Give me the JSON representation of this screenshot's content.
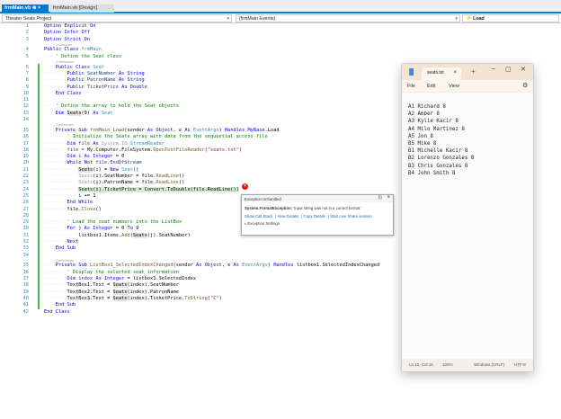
{
  "tabs": [
    {
      "label": "frmMain.vb",
      "pin": "⊕",
      "close": "×"
    },
    {
      "label": "frmMain.vb [Design]"
    }
  ],
  "nav": {
    "project": "Theater Seats Project",
    "events": "(frmMain Events)",
    "member": "Load"
  },
  "code": [
    {
      "n": "1",
      "seg": [
        [
          "Option Explicit On",
          "k"
        ]
      ]
    },
    {
      "n": "2",
      "seg": [
        [
          "Option Infer Off",
          "k"
        ]
      ]
    },
    {
      "n": "3",
      "seg": [
        [
          "Option Strict On",
          "k"
        ]
      ]
    },
    {
      "ref": "1 reference"
    },
    {
      "n": "4",
      "seg": [
        [
          "Public Class ",
          "k"
        ],
        [
          "frmMain",
          "t"
        ]
      ]
    },
    {
      "n": "5",
      "seg": [
        [
          "····",
          "w"
        ],
        [
          "' Define the Seat class",
          "c"
        ]
      ]
    },
    {
      "ref": "2 references"
    },
    {
      "n": "6",
      "seg": [
        [
          "····",
          "w"
        ],
        [
          "Public Class ",
          "k"
        ],
        [
          "Seat",
          "t"
        ]
      ]
    },
    {
      "n": "7",
      "seg": [
        [
          "········",
          "w"
        ],
        [
          "Public ",
          "k"
        ],
        [
          "SeatNumber ",
          "f"
        ],
        [
          "As String",
          "k"
        ]
      ]
    },
    {
      "n": "8",
      "seg": [
        [
          "········",
          "w"
        ],
        [
          "Public ",
          "k"
        ],
        [
          "PatronName ",
          "f"
        ],
        [
          "As String",
          "k"
        ]
      ]
    },
    {
      "n": "9",
      "seg": [
        [
          "········",
          "w"
        ],
        [
          "Public ",
          "k"
        ],
        [
          "TicketPrice ",
          "f"
        ],
        [
          "As Double",
          "k"
        ]
      ]
    },
    {
      "n": "10",
      "seg": [
        [
          "····",
          "w"
        ],
        [
          "End Class",
          "k"
        ]
      ]
    },
    {
      "n": "11",
      "seg": []
    },
    {
      "n": "12",
      "seg": [
        [
          "····",
          "w"
        ],
        [
          "' Define the array to hold the Seat objects",
          "c"
        ]
      ]
    },
    {
      "n": "13",
      "seg": [
        [
          "····",
          "w"
        ],
        [
          "Dim ",
          "k"
        ],
        [
          "Seats",
          "h"
        ],
        [
          "(9) ",
          "p"
        ],
        [
          "As ",
          "k"
        ],
        [
          "Seat",
          "t"
        ]
      ]
    },
    {
      "n": "14",
      "seg": []
    },
    {
      "ref": "0 references"
    },
    {
      "n": "15",
      "seg": [
        [
          "····",
          "w"
        ],
        [
          "Private Sub ",
          "k"
        ],
        [
          "frmMain_Load",
          "m"
        ],
        [
          "(sender ",
          "p"
        ],
        [
          "As Object",
          "k"
        ],
        [
          ", e ",
          "p"
        ],
        [
          "As ",
          "k"
        ],
        [
          "EventArgs",
          "t"
        ],
        [
          ") ",
          "p"
        ],
        [
          "Handles MyBase",
          "k"
        ],
        [
          ".Load",
          "p"
        ]
      ]
    },
    {
      "n": "16",
      "seg": [
        [
          "········",
          "w"
        ],
        [
          "' Initialize the Seats array with data from the sequential access file",
          "c"
        ]
      ]
    },
    {
      "n": "17",
      "seg": [
        [
          "········",
          "w"
        ],
        [
          "Dim ",
          "k"
        ],
        [
          "file ",
          "f"
        ],
        [
          "As ",
          "k"
        ],
        [
          "System.IO.",
          "g"
        ],
        [
          "StreamReader",
          "t"
        ]
      ]
    },
    {
      "n": "18",
      "seg": [
        [
          "········",
          "w"
        ],
        [
          "file = ",
          "f"
        ],
        [
          "My",
          "k"
        ],
        [
          ".Computer.FileSystem.",
          "p"
        ],
        [
          "OpenTextFileReader",
          "m"
        ],
        [
          "(",
          "p"
        ],
        [
          "\"seats.txt\"",
          "s"
        ],
        [
          ")",
          "p"
        ]
      ]
    },
    {
      "n": "19",
      "seg": [
        [
          "········",
          "w"
        ],
        [
          "Dim ",
          "k"
        ],
        [
          "i ",
          "f"
        ],
        [
          "As Integer",
          "k"
        ],
        [
          " = 0",
          "p"
        ]
      ]
    },
    {
      "n": "20",
      "seg": [
        [
          "········",
          "w"
        ],
        [
          "While Not ",
          "k"
        ],
        [
          "file.EndOfStream",
          "f"
        ]
      ]
    },
    {
      "n": "21",
      "seg": [
        [
          "············",
          "w"
        ],
        [
          "Seats",
          "h"
        ],
        [
          "(i) = ",
          "p"
        ],
        [
          "New ",
          "k"
        ],
        [
          "Seat",
          "t"
        ],
        [
          "()",
          "p"
        ]
      ]
    },
    {
      "n": "22",
      "seg": [
        [
          "············",
          "w"
        ],
        [
          "Seats",
          "g"
        ],
        [
          "(i).SeatNumber = file.",
          "p"
        ],
        [
          "ReadLine",
          "m"
        ],
        [
          "()",
          "p"
        ]
      ]
    },
    {
      "n": "23",
      "seg": [
        [
          "············",
          "w"
        ],
        [
          "Seats",
          "g"
        ],
        [
          "(i).PatronName = file.",
          "p"
        ],
        [
          "ReadLine",
          "m"
        ],
        [
          "()",
          "p"
        ]
      ]
    },
    {
      "n": "24",
      "cur": true,
      "seg": [
        [
          "············",
          "w"
        ],
        [
          "Seats(i).TicketPrice = Convert.ToDouble(file.ReadLine())",
          "cur"
        ]
      ]
    },
    {
      "n": "25",
      "seg": [
        [
          "············",
          "w"
        ],
        [
          "i += 1",
          "p"
        ]
      ]
    },
    {
      "n": "26",
      "seg": [
        [
          "········",
          "w"
        ],
        [
          "End While",
          "k"
        ]
      ]
    },
    {
      "n": "27",
      "seg": [
        [
          "········",
          "w"
        ],
        [
          "file.",
          "p"
        ],
        [
          "Close",
          "m"
        ],
        [
          "()",
          "p"
        ]
      ]
    },
    {
      "n": "28",
      "seg": []
    },
    {
      "n": "29",
      "seg": [
        [
          "········",
          "w"
        ],
        [
          "' Load the seat numbers into the ListBox",
          "c"
        ]
      ]
    },
    {
      "n": "30",
      "seg": [
        [
          "········",
          "w"
        ],
        [
          "For ",
          "k"
        ],
        [
          "j ",
          "f"
        ],
        [
          "As Integer",
          "k"
        ],
        [
          " = 0 ",
          "p"
        ],
        [
          "To ",
          "k"
        ],
        [
          "9",
          "p"
        ]
      ]
    },
    {
      "n": "31",
      "seg": [
        [
          "············",
          "w"
        ],
        [
          "listbox1.Items.",
          "p"
        ],
        [
          "Add",
          "m"
        ],
        [
          "(",
          "p"
        ],
        [
          "Seats",
          "h"
        ],
        [
          "(j).SeatNumber)",
          "p"
        ]
      ]
    },
    {
      "n": "32",
      "seg": [
        [
          "········",
          "w"
        ],
        [
          "Next",
          "k"
        ]
      ]
    },
    {
      "n": "33",
      "seg": [
        [
          "····",
          "w"
        ],
        [
          "End Sub",
          "k"
        ]
      ]
    },
    {
      "n": "34",
      "seg": []
    },
    {
      "ref": "0 references"
    },
    {
      "n": "35",
      "seg": [
        [
          "····",
          "w"
        ],
        [
          "Private Sub ",
          "k"
        ],
        [
          "ListBox1_SelectedIndexChanged",
          "m"
        ],
        [
          "(sender ",
          "p"
        ],
        [
          "As Object",
          "k"
        ],
        [
          ", e ",
          "p"
        ],
        [
          "As ",
          "k"
        ],
        [
          "EventArgs",
          "t"
        ],
        [
          ") ",
          "p"
        ],
        [
          "Handles ",
          "k"
        ],
        [
          "listbox1.SelectedIndexChanged",
          "p"
        ]
      ]
    },
    {
      "n": "36",
      "seg": [
        [
          "········",
          "w"
        ],
        [
          "' Display the selected seat information",
          "c"
        ]
      ]
    },
    {
      "n": "37",
      "seg": [
        [
          "········",
          "w"
        ],
        [
          "Dim ",
          "k"
        ],
        [
          "index ",
          "f"
        ],
        [
          "As Integer",
          "k"
        ],
        [
          " = listbox1.SelectedIndex",
          "p"
        ]
      ]
    },
    {
      "n": "38",
      "seg": [
        [
          "········",
          "w"
        ],
        [
          "TextBox1.Text = ",
          "p"
        ],
        [
          "Seats",
          "h"
        ],
        [
          "(index).SeatNumber",
          "p"
        ]
      ]
    },
    {
      "n": "39",
      "seg": [
        [
          "········",
          "w"
        ],
        [
          "TextBox2.Text = ",
          "p"
        ],
        [
          "Seats",
          "h"
        ],
        [
          "(index).PatronName",
          "p"
        ]
      ]
    },
    {
      "n": "40",
      "seg": [
        [
          "········",
          "w"
        ],
        [
          "TextBox3.Text = ",
          "p"
        ],
        [
          "Seats",
          "h"
        ],
        [
          "(index).TicketPrice.",
          "p"
        ],
        [
          "ToString",
          "m"
        ],
        [
          "(",
          "p"
        ],
        [
          "\"C\"",
          "s"
        ],
        [
          ")",
          "p"
        ]
      ]
    },
    {
      "n": "41",
      "seg": [
        [
          "····",
          "w"
        ],
        [
          "End Sub",
          "k"
        ]
      ]
    },
    {
      "n": "42",
      "seg": [
        [
          "End Class",
          "k"
        ]
      ]
    }
  ],
  "exception": {
    "title": "Exception Unhandled",
    "type": "System.FormatException:",
    "message": " 'Input string was not in a correct format.'",
    "links": [
      "Show Call Stack",
      "View Details",
      "Copy Details",
      "Start Live Share session"
    ],
    "settings": "▹ Exception Settings"
  },
  "notepad": {
    "tab": "seats.txt",
    "menu": [
      "File",
      "Edit",
      "View"
    ],
    "content": "A1 Richard 8\nA2 Amber 8\nA3 Kylie Kacir 8\nA4 Milo Martinez 8\nA5 Jon 8\nB5 Mike 8\nB1 Michelle Kacir 8\nB2 Lorenzo Gonzales 8\nB3 Chris Gonzales 8\nB4 John Smith 8",
    "status": {
      "pos": "Ln 10, Col 16",
      "zoom": "100%",
      "eol": "Windows (CRLF)",
      "enc": "UTF-8"
    }
  }
}
